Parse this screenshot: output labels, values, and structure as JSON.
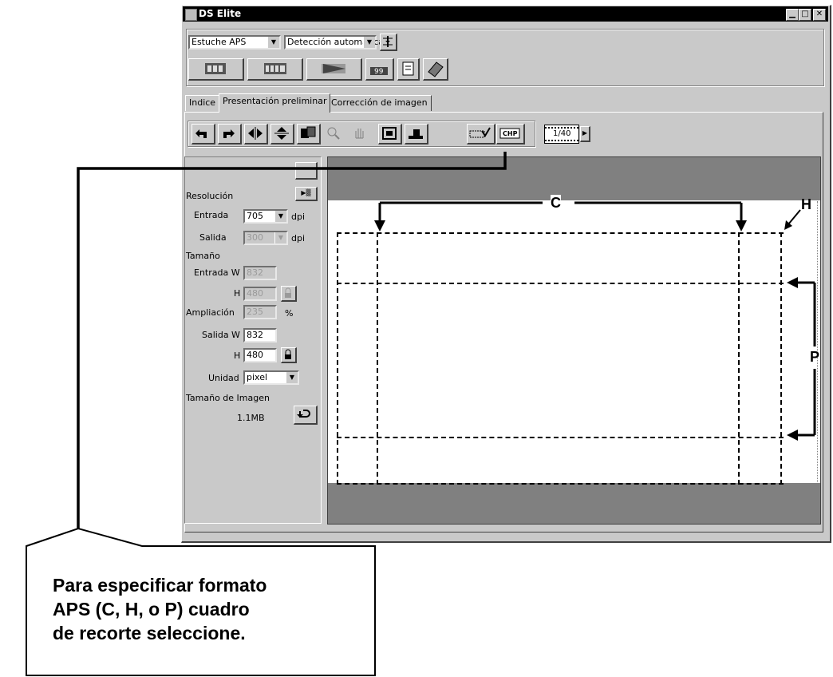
{
  "window": {
    "title": "DS Elite"
  },
  "toolbar": {
    "film_type": "Estuche APS",
    "detection": "Detección automática"
  },
  "tabs": [
    "Indice",
    "Presentación preliminar",
    "Corrección de imagen"
  ],
  "frame_counter": "1/40",
  "panel": {
    "resolution_label": "Resolución",
    "input_label": "Entrada",
    "input_value": "705",
    "output_label": "Salida",
    "output_value": "300",
    "dpi": "dpi",
    "size_label": "Tamaño",
    "input_w_label": "Entrada W",
    "input_w_value": "832",
    "h_label": "H",
    "input_h_value": "480",
    "magnification_label": "Ampliación",
    "magnification_value": "235",
    "percent": "%",
    "output_w_label": "Salida W",
    "output_w_value": "832",
    "output_h_value": "480",
    "unit_label": "Unidad",
    "unit_value": "pixel",
    "image_size_label": "Tamaño de Imagen",
    "image_size_value": "1.1MB"
  },
  "annotations": {
    "c": "C",
    "h": "H",
    "p": "P",
    "callout_line1": "Para especificar formato",
    "callout_line2": "APS (C, H, o P) cuadro",
    "callout_line3": "de recorte seleccione."
  }
}
